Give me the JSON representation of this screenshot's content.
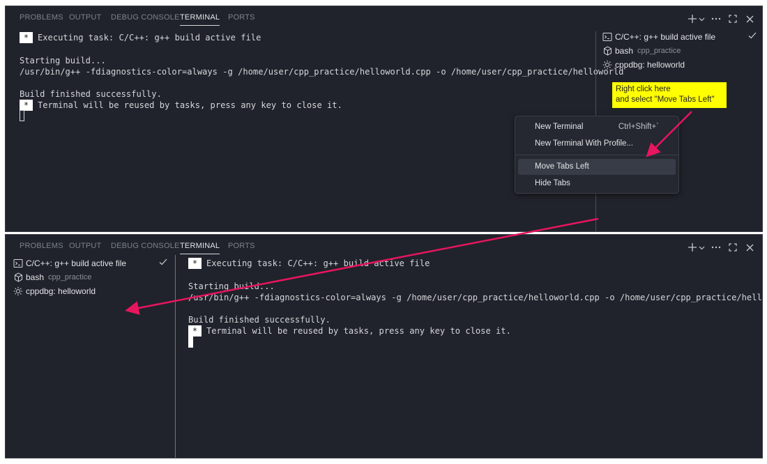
{
  "panel_tabs": [
    "PROBLEMS",
    "OUTPUT",
    "DEBUG CONSOLE",
    "TERMINAL",
    "PORTS"
  ],
  "active_tab": "TERMINAL",
  "terminal": {
    "star": "*",
    "executing_line": "Executing task: C/C++: g++ build active file",
    "starting_build": "Starting build...",
    "command": "/usr/bin/g++ -fdiagnostics-color=always -g /home/user/cpp_practice/helloworld.cpp -o /home/user/cpp_practice/helloworld",
    "finished": "Build finished successfully.",
    "reuse_message": "Terminal will be reused by tasks, press any key to close it."
  },
  "terminal_tabs": [
    {
      "label": "C/C++: g++ build active file",
      "desc": "",
      "icon": "terminal-icon",
      "status": "check"
    },
    {
      "label": "bash",
      "desc": "cpp_practice",
      "icon": "shell-icon",
      "status": ""
    },
    {
      "label": "cppdbg: helloworld",
      "desc": "",
      "icon": "debug-gear-icon",
      "status": ""
    }
  ],
  "context_menu": {
    "items": [
      {
        "label": "New Terminal",
        "shortcut": "Ctrl+Shift+`"
      },
      {
        "label": "New Terminal With Profile...",
        "shortcut": ""
      },
      {
        "label": "Move Tabs Left",
        "shortcut": ""
      },
      {
        "label": "Hide Tabs",
        "shortcut": ""
      }
    ],
    "selected_index": 2
  },
  "callout": {
    "line1": "Right click here",
    "line2": "and select \"Move Tabs Left\""
  },
  "colors": {
    "panel_bg": "#20232b",
    "arrow": "#e8155f",
    "callout_bg": "#ffff00",
    "tabs_divider_accent": "#6f66c7"
  }
}
